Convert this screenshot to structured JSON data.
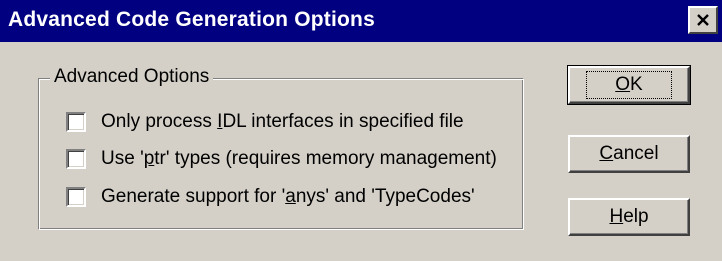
{
  "window": {
    "title": "Advanced Code Generation Options",
    "close_glyph": "✕"
  },
  "group": {
    "legend": "Advanced Options",
    "options": [
      {
        "pre": "Only process ",
        "mnemonic": "I",
        "post": "DL interfaces in specified file",
        "checked": false
      },
      {
        "pre": "Use '",
        "mnemonic": "p",
        "post": "tr' types (requires memory management)",
        "checked": false
      },
      {
        "pre": "Generate support for '",
        "mnemonic": "a",
        "post": "nys' and 'TypeCodes'",
        "checked": false
      }
    ]
  },
  "buttons": {
    "ok": {
      "mnemonic": "O",
      "rest": "K"
    },
    "cancel": {
      "mnemonic": "C",
      "rest": "ancel"
    },
    "help": {
      "mnemonic": "H",
      "rest": "elp"
    }
  },
  "colors": {
    "titlebar": "#000080",
    "face": "#d4d0c8"
  }
}
